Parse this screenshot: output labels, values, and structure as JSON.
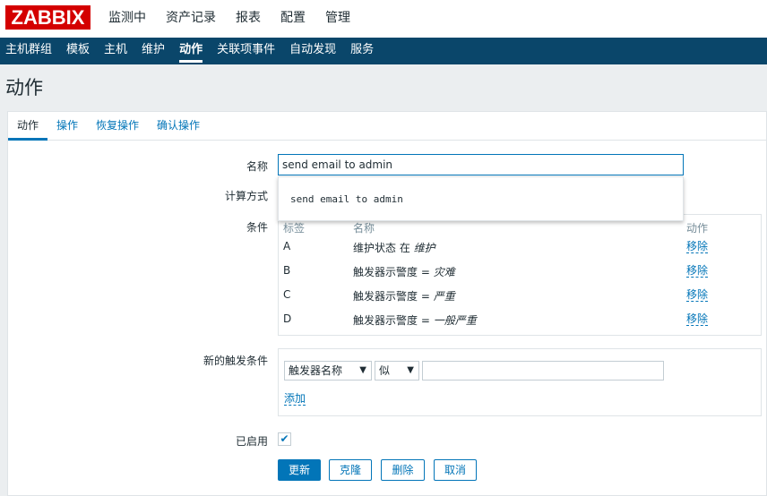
{
  "logo": {
    "text": "ZABBIX",
    "color": "#d40000"
  },
  "topnav": [
    {
      "label": "监测中"
    },
    {
      "label": "资产记录"
    },
    {
      "label": "报表"
    },
    {
      "label": "配置",
      "active": true
    },
    {
      "label": "管理"
    }
  ],
  "subnav": [
    {
      "label": "主机群组"
    },
    {
      "label": "模板"
    },
    {
      "label": "主机"
    },
    {
      "label": "维护"
    },
    {
      "label": "动作",
      "active": true
    },
    {
      "label": "关联项事件"
    },
    {
      "label": "自动发现"
    },
    {
      "label": "服务"
    }
  ],
  "page": {
    "title": "动作"
  },
  "tabs": [
    {
      "label": "动作",
      "active": true
    },
    {
      "label": "操作"
    },
    {
      "label": "恢复操作"
    },
    {
      "label": "确认操作"
    }
  ],
  "form": {
    "name_label": "名称",
    "name_value": "send email to admin",
    "suggestion": "send email to admin",
    "calc_label": "计算方式",
    "conditions_label": "条件",
    "conditions": {
      "headers": {
        "label": "标签",
        "name": "名称",
        "action": "动作"
      },
      "rows": [
        {
          "label": "A",
          "name_prefix": "维护状态 在 ",
          "name_value": "维护",
          "action": "移除"
        },
        {
          "label": "B",
          "name_prefix": "触发器示警度 = ",
          "name_value": "灾难",
          "action": "移除"
        },
        {
          "label": "C",
          "name_prefix": "触发器示警度 = ",
          "name_value": "严重",
          "action": "移除"
        },
        {
          "label": "D",
          "name_prefix": "触发器示警度 = ",
          "name_value": "一般严重",
          "action": "移除"
        }
      ]
    },
    "new_condition_label": "新的触发条件",
    "new_condition": {
      "type_select": "触发器名称",
      "operator_select": "似",
      "value": "",
      "add_link": "添加"
    },
    "enabled_label": "已启用",
    "enabled": true
  },
  "buttons": {
    "update": "更新",
    "clone": "克隆",
    "delete": "删除",
    "cancel": "取消"
  },
  "colors": {
    "accent": "#0275b8",
    "nav_bg": "#0a466a",
    "page_bg": "#ebeef0"
  }
}
